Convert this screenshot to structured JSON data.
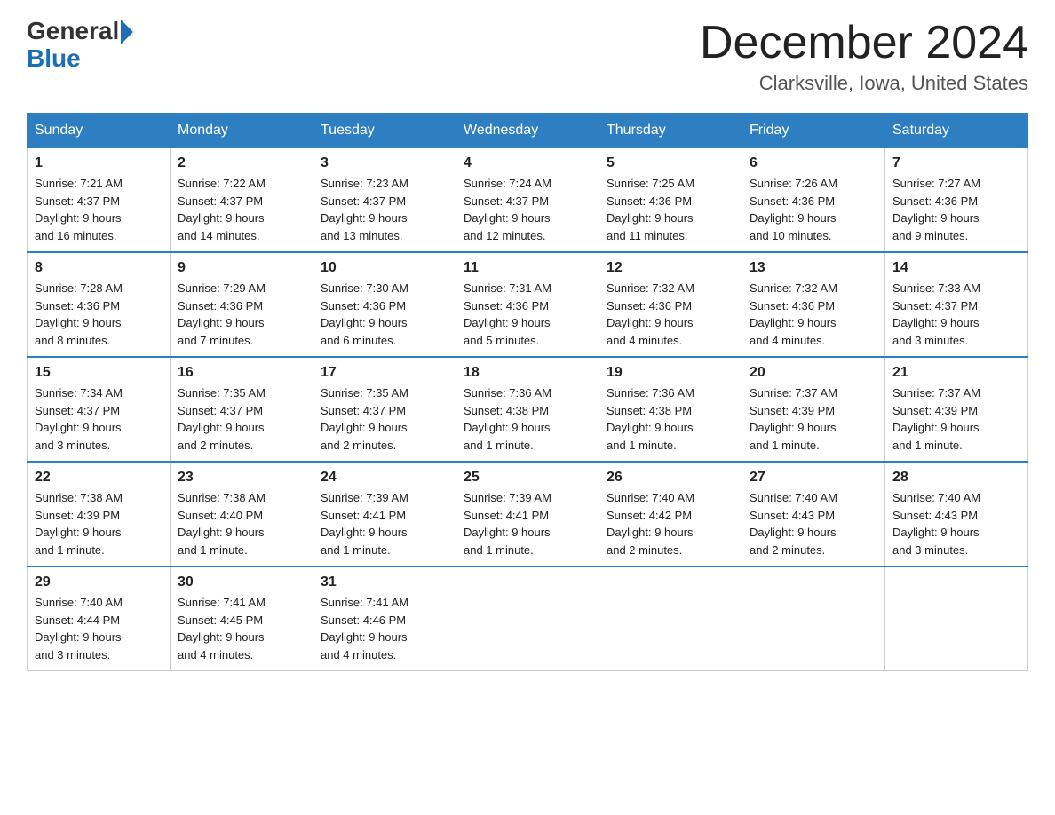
{
  "logo": {
    "text_general": "General",
    "text_blue": "Blue"
  },
  "title": "December 2024",
  "location": "Clarksville, Iowa, United States",
  "days_of_week": [
    "Sunday",
    "Monday",
    "Tuesday",
    "Wednesday",
    "Thursday",
    "Friday",
    "Saturday"
  ],
  "weeks": [
    [
      {
        "day": "1",
        "sunrise": "7:21 AM",
        "sunset": "4:37 PM",
        "daylight": "9 hours and 16 minutes."
      },
      {
        "day": "2",
        "sunrise": "7:22 AM",
        "sunset": "4:37 PM",
        "daylight": "9 hours and 14 minutes."
      },
      {
        "day": "3",
        "sunrise": "7:23 AM",
        "sunset": "4:37 PM",
        "daylight": "9 hours and 13 minutes."
      },
      {
        "day": "4",
        "sunrise": "7:24 AM",
        "sunset": "4:37 PM",
        "daylight": "9 hours and 12 minutes."
      },
      {
        "day": "5",
        "sunrise": "7:25 AM",
        "sunset": "4:36 PM",
        "daylight": "9 hours and 11 minutes."
      },
      {
        "day": "6",
        "sunrise": "7:26 AM",
        "sunset": "4:36 PM",
        "daylight": "9 hours and 10 minutes."
      },
      {
        "day": "7",
        "sunrise": "7:27 AM",
        "sunset": "4:36 PM",
        "daylight": "9 hours and 9 minutes."
      }
    ],
    [
      {
        "day": "8",
        "sunrise": "7:28 AM",
        "sunset": "4:36 PM",
        "daylight": "9 hours and 8 minutes."
      },
      {
        "day": "9",
        "sunrise": "7:29 AM",
        "sunset": "4:36 PM",
        "daylight": "9 hours and 7 minutes."
      },
      {
        "day": "10",
        "sunrise": "7:30 AM",
        "sunset": "4:36 PM",
        "daylight": "9 hours and 6 minutes."
      },
      {
        "day": "11",
        "sunrise": "7:31 AM",
        "sunset": "4:36 PM",
        "daylight": "9 hours and 5 minutes."
      },
      {
        "day": "12",
        "sunrise": "7:32 AM",
        "sunset": "4:36 PM",
        "daylight": "9 hours and 4 minutes."
      },
      {
        "day": "13",
        "sunrise": "7:32 AM",
        "sunset": "4:36 PM",
        "daylight": "9 hours and 4 minutes."
      },
      {
        "day": "14",
        "sunrise": "7:33 AM",
        "sunset": "4:37 PM",
        "daylight": "9 hours and 3 minutes."
      }
    ],
    [
      {
        "day": "15",
        "sunrise": "7:34 AM",
        "sunset": "4:37 PM",
        "daylight": "9 hours and 3 minutes."
      },
      {
        "day": "16",
        "sunrise": "7:35 AM",
        "sunset": "4:37 PM",
        "daylight": "9 hours and 2 minutes."
      },
      {
        "day": "17",
        "sunrise": "7:35 AM",
        "sunset": "4:37 PM",
        "daylight": "9 hours and 2 minutes."
      },
      {
        "day": "18",
        "sunrise": "7:36 AM",
        "sunset": "4:38 PM",
        "daylight": "9 hours and 1 minute."
      },
      {
        "day": "19",
        "sunrise": "7:36 AM",
        "sunset": "4:38 PM",
        "daylight": "9 hours and 1 minute."
      },
      {
        "day": "20",
        "sunrise": "7:37 AM",
        "sunset": "4:39 PM",
        "daylight": "9 hours and 1 minute."
      },
      {
        "day": "21",
        "sunrise": "7:37 AM",
        "sunset": "4:39 PM",
        "daylight": "9 hours and 1 minute."
      }
    ],
    [
      {
        "day": "22",
        "sunrise": "7:38 AM",
        "sunset": "4:39 PM",
        "daylight": "9 hours and 1 minute."
      },
      {
        "day": "23",
        "sunrise": "7:38 AM",
        "sunset": "4:40 PM",
        "daylight": "9 hours and 1 minute."
      },
      {
        "day": "24",
        "sunrise": "7:39 AM",
        "sunset": "4:41 PM",
        "daylight": "9 hours and 1 minute."
      },
      {
        "day": "25",
        "sunrise": "7:39 AM",
        "sunset": "4:41 PM",
        "daylight": "9 hours and 1 minute."
      },
      {
        "day": "26",
        "sunrise": "7:40 AM",
        "sunset": "4:42 PM",
        "daylight": "9 hours and 2 minutes."
      },
      {
        "day": "27",
        "sunrise": "7:40 AM",
        "sunset": "4:43 PM",
        "daylight": "9 hours and 2 minutes."
      },
      {
        "day": "28",
        "sunrise": "7:40 AM",
        "sunset": "4:43 PM",
        "daylight": "9 hours and 3 minutes."
      }
    ],
    [
      {
        "day": "29",
        "sunrise": "7:40 AM",
        "sunset": "4:44 PM",
        "daylight": "9 hours and 3 minutes."
      },
      {
        "day": "30",
        "sunrise": "7:41 AM",
        "sunset": "4:45 PM",
        "daylight": "9 hours and 4 minutes."
      },
      {
        "day": "31",
        "sunrise": "7:41 AM",
        "sunset": "4:46 PM",
        "daylight": "9 hours and 4 minutes."
      },
      null,
      null,
      null,
      null
    ]
  ],
  "labels": {
    "sunrise": "Sunrise:",
    "sunset": "Sunset:",
    "daylight": "Daylight:"
  }
}
